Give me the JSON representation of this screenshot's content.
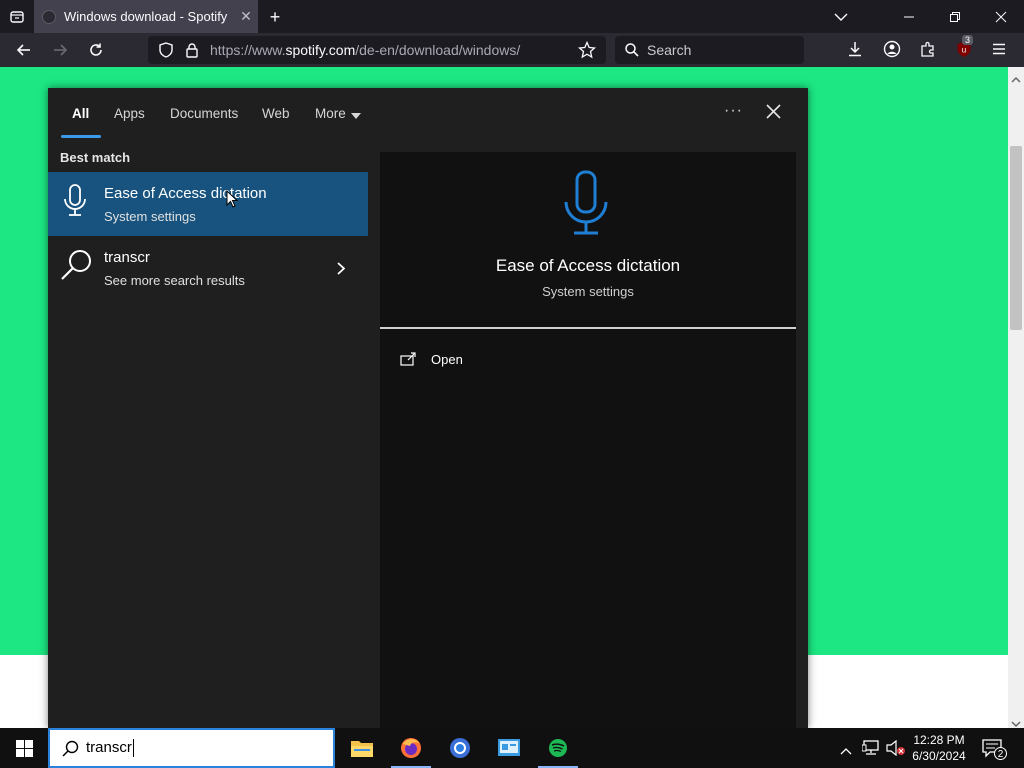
{
  "browser": {
    "tab_title": "Windows download - Spotify",
    "url_prefix": "https://www.",
    "url_domain": "spotify.com",
    "url_path": "/de-en/download/windows/",
    "search_placeholder": "Search",
    "extension_badge": "3"
  },
  "search_panel": {
    "filters": [
      "All",
      "Apps",
      "Documents",
      "Web",
      "More"
    ],
    "active_filter": "All",
    "best_match_label": "Best match",
    "results": [
      {
        "title": "Ease of Access dictation",
        "subtitle": "System settings"
      },
      {
        "title": "transcr",
        "subtitle": "See more search results"
      }
    ],
    "detail": {
      "title": "Ease of Access dictation",
      "subtitle": "System settings",
      "action_open": "Open"
    },
    "accent_color": "#3b9be8",
    "selected_color": "#17537e"
  },
  "taskbar": {
    "search_query": "transcr",
    "time": "12:28 PM",
    "date": "6/30/2024",
    "notification_count": "2"
  }
}
